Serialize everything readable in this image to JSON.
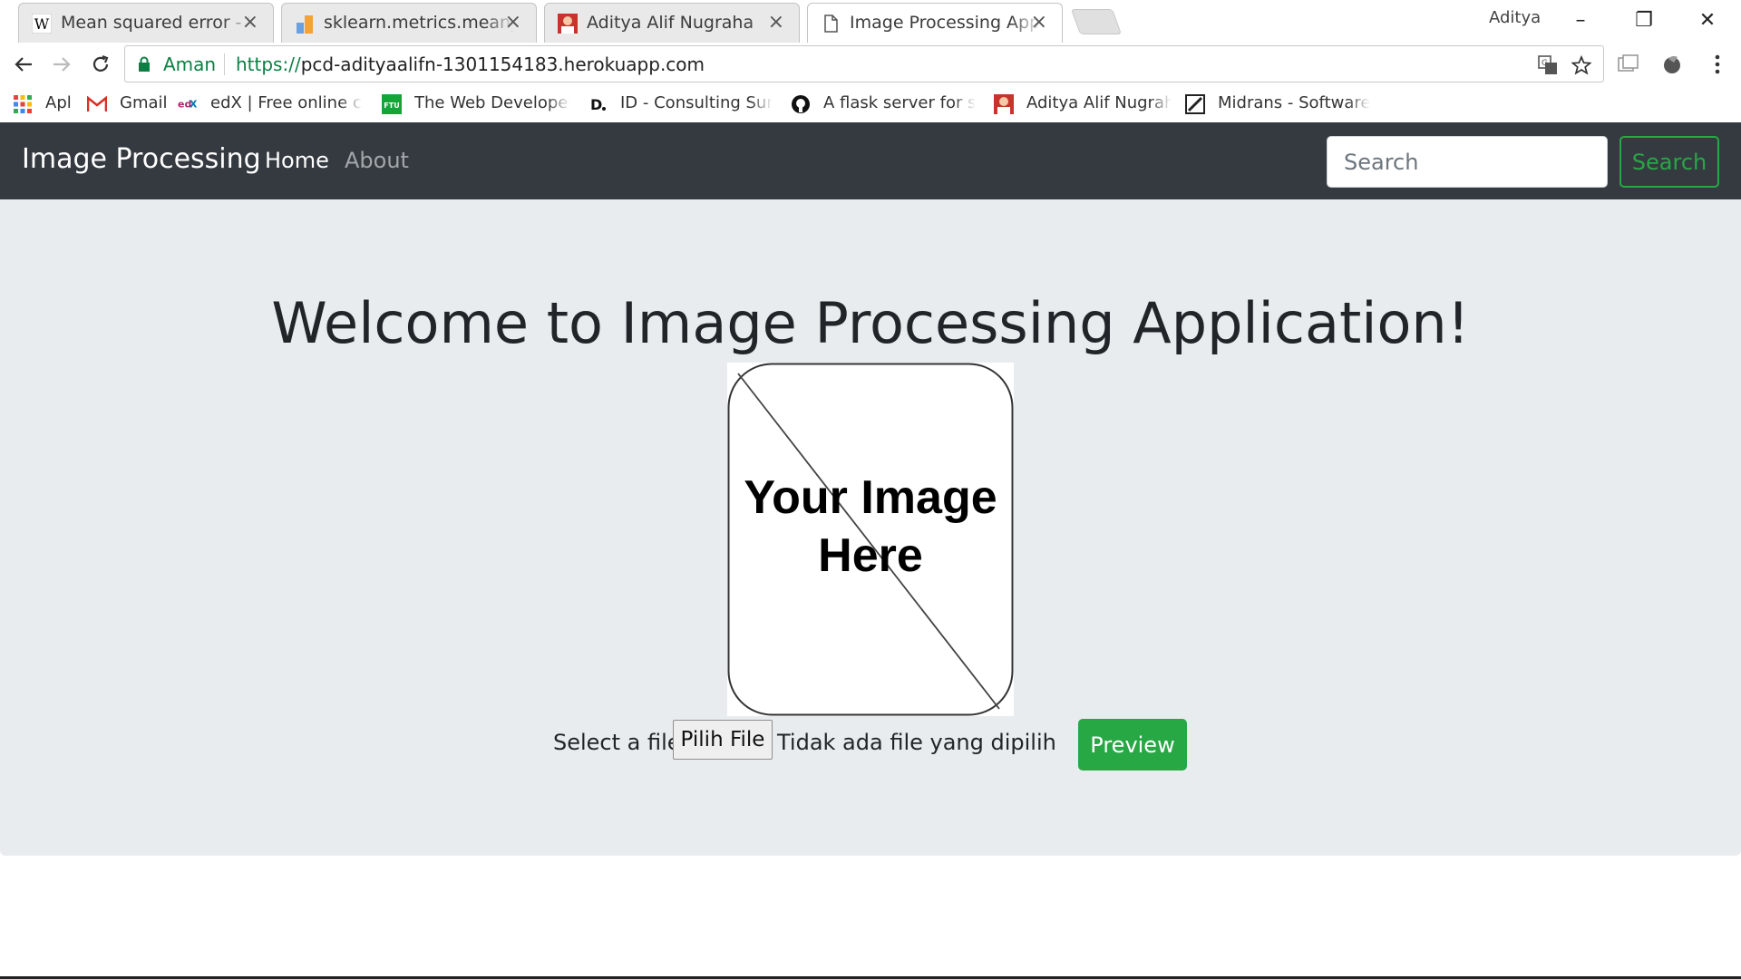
{
  "browser": {
    "tabs": [
      {
        "title": "Mean squared error - Wikipedia",
        "favicon": "wikipedia-icon",
        "close": "×"
      },
      {
        "title": "sklearn.metrics.mean_squared_error",
        "favicon": "bookmark-chart-icon",
        "close": "×"
      },
      {
        "title": "Aditya Alif Nugraha",
        "favicon": "profile-photo-icon",
        "close": "×"
      },
      {
        "title": "Image Processing Application",
        "favicon": "page-icon",
        "close": "×",
        "active": true
      }
    ],
    "profile_name": "Aditya",
    "window_controls": {
      "minimize": "–",
      "restore": "❐",
      "close": "✕"
    },
    "omnibox": {
      "secure_label": "Aman",
      "url_scheme": "https://",
      "url_host": "pcd-adityaalifn-1301154183.herokuapp.com"
    },
    "bookmarks": [
      {
        "label": "Apl",
        "icon": "apps-grid-icon"
      },
      {
        "label": "Gmail",
        "icon": "gmail-icon"
      },
      {
        "label": "edX | Free online courses",
        "icon": "edx-icon"
      },
      {
        "label": "The Web Developer Bootcamp",
        "icon": "ftu-icon"
      },
      {
        "label": "ID - Consulting Summary",
        "icon": "d-icon"
      },
      {
        "label": "A flask server for serving",
        "icon": "github-icon"
      },
      {
        "label": "Aditya Alif Nugraha",
        "icon": "profile-photo-icon"
      },
      {
        "label": "Midrans - Software Engineer",
        "icon": "pen-icon"
      }
    ],
    "colors": {
      "secure": "#0b8043"
    }
  },
  "navbar": {
    "brand": "Image Processing",
    "links": [
      {
        "label": "Home",
        "active": true
      },
      {
        "label": "About",
        "active": false
      }
    ],
    "search_placeholder": "Search",
    "search_button": "Search",
    "colors": {
      "background": "#343a40",
      "success": "#28a745"
    }
  },
  "main": {
    "heading": "Welcome to Image Processing Application!",
    "placeholder_image_text_line1": "Your Image",
    "placeholder_image_text_line2": "Here",
    "file_label": "Select a file:",
    "file_button": "Pilih File",
    "file_status": "Tidak ada file yang dipilih",
    "preview_button": "Preview",
    "colors": {
      "jumbotron": "#e9ecef",
      "primary_button": "#28a745"
    }
  }
}
